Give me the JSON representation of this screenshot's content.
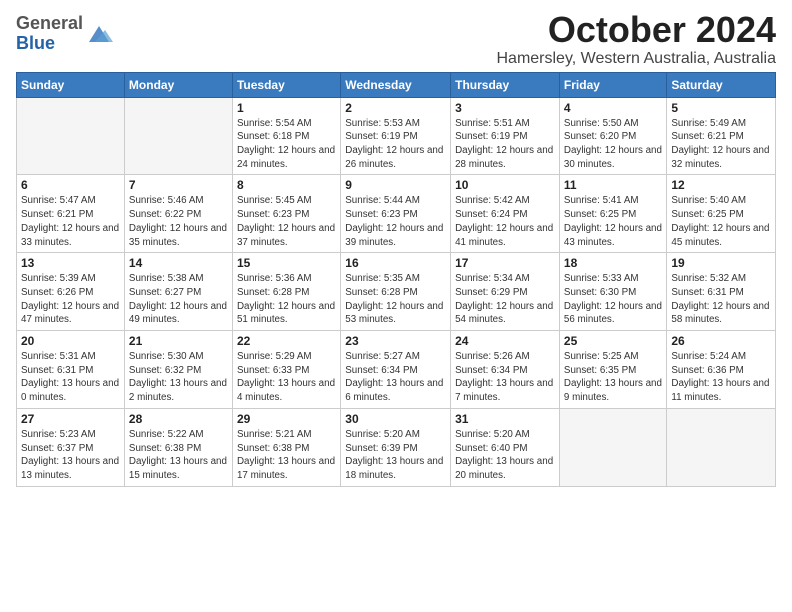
{
  "header": {
    "logo_general": "General",
    "logo_blue": "Blue",
    "title": "October 2024",
    "subtitle": "Hamersley, Western Australia, Australia"
  },
  "days_of_week": [
    "Sunday",
    "Monday",
    "Tuesday",
    "Wednesday",
    "Thursday",
    "Friday",
    "Saturday"
  ],
  "weeks": [
    [
      {
        "day": "",
        "info": ""
      },
      {
        "day": "",
        "info": ""
      },
      {
        "day": "1",
        "info": "Sunrise: 5:54 AM\nSunset: 6:18 PM\nDaylight: 12 hours and 24 minutes."
      },
      {
        "day": "2",
        "info": "Sunrise: 5:53 AM\nSunset: 6:19 PM\nDaylight: 12 hours and 26 minutes."
      },
      {
        "day": "3",
        "info": "Sunrise: 5:51 AM\nSunset: 6:19 PM\nDaylight: 12 hours and 28 minutes."
      },
      {
        "day": "4",
        "info": "Sunrise: 5:50 AM\nSunset: 6:20 PM\nDaylight: 12 hours and 30 minutes."
      },
      {
        "day": "5",
        "info": "Sunrise: 5:49 AM\nSunset: 6:21 PM\nDaylight: 12 hours and 32 minutes."
      }
    ],
    [
      {
        "day": "6",
        "info": "Sunrise: 5:47 AM\nSunset: 6:21 PM\nDaylight: 12 hours and 33 minutes."
      },
      {
        "day": "7",
        "info": "Sunrise: 5:46 AM\nSunset: 6:22 PM\nDaylight: 12 hours and 35 minutes."
      },
      {
        "day": "8",
        "info": "Sunrise: 5:45 AM\nSunset: 6:23 PM\nDaylight: 12 hours and 37 minutes."
      },
      {
        "day": "9",
        "info": "Sunrise: 5:44 AM\nSunset: 6:23 PM\nDaylight: 12 hours and 39 minutes."
      },
      {
        "day": "10",
        "info": "Sunrise: 5:42 AM\nSunset: 6:24 PM\nDaylight: 12 hours and 41 minutes."
      },
      {
        "day": "11",
        "info": "Sunrise: 5:41 AM\nSunset: 6:25 PM\nDaylight: 12 hours and 43 minutes."
      },
      {
        "day": "12",
        "info": "Sunrise: 5:40 AM\nSunset: 6:25 PM\nDaylight: 12 hours and 45 minutes."
      }
    ],
    [
      {
        "day": "13",
        "info": "Sunrise: 5:39 AM\nSunset: 6:26 PM\nDaylight: 12 hours and 47 minutes."
      },
      {
        "day": "14",
        "info": "Sunrise: 5:38 AM\nSunset: 6:27 PM\nDaylight: 12 hours and 49 minutes."
      },
      {
        "day": "15",
        "info": "Sunrise: 5:36 AM\nSunset: 6:28 PM\nDaylight: 12 hours and 51 minutes."
      },
      {
        "day": "16",
        "info": "Sunrise: 5:35 AM\nSunset: 6:28 PM\nDaylight: 12 hours and 53 minutes."
      },
      {
        "day": "17",
        "info": "Sunrise: 5:34 AM\nSunset: 6:29 PM\nDaylight: 12 hours and 54 minutes."
      },
      {
        "day": "18",
        "info": "Sunrise: 5:33 AM\nSunset: 6:30 PM\nDaylight: 12 hours and 56 minutes."
      },
      {
        "day": "19",
        "info": "Sunrise: 5:32 AM\nSunset: 6:31 PM\nDaylight: 12 hours and 58 minutes."
      }
    ],
    [
      {
        "day": "20",
        "info": "Sunrise: 5:31 AM\nSunset: 6:31 PM\nDaylight: 13 hours and 0 minutes."
      },
      {
        "day": "21",
        "info": "Sunrise: 5:30 AM\nSunset: 6:32 PM\nDaylight: 13 hours and 2 minutes."
      },
      {
        "day": "22",
        "info": "Sunrise: 5:29 AM\nSunset: 6:33 PM\nDaylight: 13 hours and 4 minutes."
      },
      {
        "day": "23",
        "info": "Sunrise: 5:27 AM\nSunset: 6:34 PM\nDaylight: 13 hours and 6 minutes."
      },
      {
        "day": "24",
        "info": "Sunrise: 5:26 AM\nSunset: 6:34 PM\nDaylight: 13 hours and 7 minutes."
      },
      {
        "day": "25",
        "info": "Sunrise: 5:25 AM\nSunset: 6:35 PM\nDaylight: 13 hours and 9 minutes."
      },
      {
        "day": "26",
        "info": "Sunrise: 5:24 AM\nSunset: 6:36 PM\nDaylight: 13 hours and 11 minutes."
      }
    ],
    [
      {
        "day": "27",
        "info": "Sunrise: 5:23 AM\nSunset: 6:37 PM\nDaylight: 13 hours and 13 minutes."
      },
      {
        "day": "28",
        "info": "Sunrise: 5:22 AM\nSunset: 6:38 PM\nDaylight: 13 hours and 15 minutes."
      },
      {
        "day": "29",
        "info": "Sunrise: 5:21 AM\nSunset: 6:38 PM\nDaylight: 13 hours and 17 minutes."
      },
      {
        "day": "30",
        "info": "Sunrise: 5:20 AM\nSunset: 6:39 PM\nDaylight: 13 hours and 18 minutes."
      },
      {
        "day": "31",
        "info": "Sunrise: 5:20 AM\nSunset: 6:40 PM\nDaylight: 13 hours and 20 minutes."
      },
      {
        "day": "",
        "info": ""
      },
      {
        "day": "",
        "info": ""
      }
    ]
  ]
}
